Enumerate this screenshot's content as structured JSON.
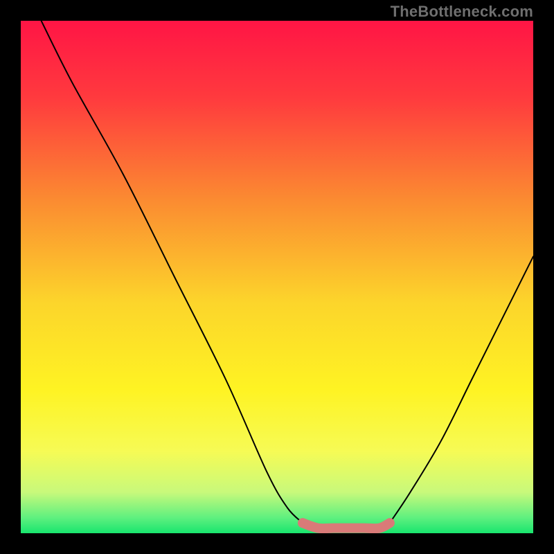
{
  "watermark": "TheBottleneck.com",
  "chart_data": {
    "type": "line",
    "title": "",
    "xlabel": "",
    "ylabel": "",
    "xlim": [
      0,
      100
    ],
    "ylim": [
      0,
      100
    ],
    "series": [
      {
        "name": "left-curve",
        "x": [
          4,
          10,
          20,
          30,
          40,
          48,
          52,
          55
        ],
        "y": [
          100,
          88,
          70,
          50,
          30,
          12,
          5,
          2
        ]
      },
      {
        "name": "right-curve",
        "x": [
          72,
          76,
          82,
          88,
          94,
          100
        ],
        "y": [
          2,
          8,
          18,
          30,
          42,
          54
        ]
      },
      {
        "name": "optimal-band",
        "x": [
          55,
          58,
          61,
          64,
          67,
          70,
          72
        ],
        "y": [
          2,
          1,
          1,
          1,
          1,
          1,
          2
        ]
      }
    ],
    "background_gradient_stops": [
      {
        "pos": 0.0,
        "color": "#ff1545"
      },
      {
        "pos": 0.15,
        "color": "#ff3a3e"
      },
      {
        "pos": 0.35,
        "color": "#fb8b31"
      },
      {
        "pos": 0.55,
        "color": "#fcd52b"
      },
      {
        "pos": 0.72,
        "color": "#fef323"
      },
      {
        "pos": 0.84,
        "color": "#f6fb55"
      },
      {
        "pos": 0.92,
        "color": "#c8f97b"
      },
      {
        "pos": 0.97,
        "color": "#5ef07f"
      },
      {
        "pos": 1.0,
        "color": "#18e56e"
      }
    ],
    "highlight_color": "#d97a78",
    "curve_color": "#000000"
  }
}
